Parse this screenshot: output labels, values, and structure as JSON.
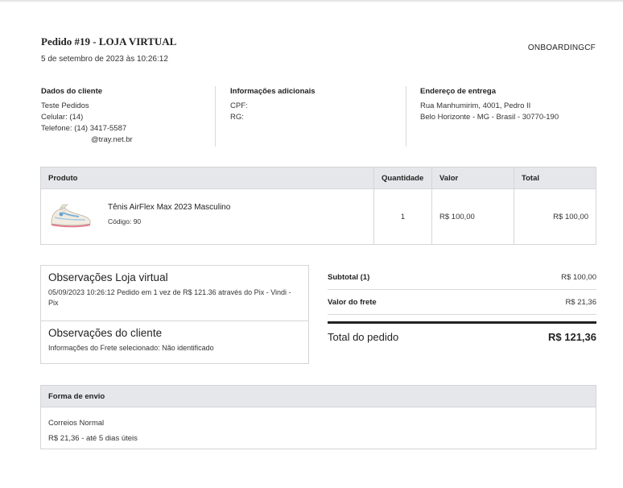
{
  "header": {
    "title": "Pedido #19 - LOJA VIRTUAL",
    "date": "5 de setembro de 2023 às 10:26:12",
    "store_code": "ONBOARDINGCF"
  },
  "customer": {
    "heading": "Dados do cliente",
    "name": "Teste Pedidos",
    "cellphone": "Celular: (14)",
    "phone": "Telefone: (14) 3417-5587",
    "email": "@tray.net.br"
  },
  "additional": {
    "heading": "Informações adicionais",
    "cpf": "CPF:",
    "rg": "RG:"
  },
  "delivery": {
    "heading": "Endereço de entrega",
    "line1": "Rua Manhumirim, 4001, Pedro II",
    "line2": "Belo Horizonte - MG - Brasil - 30770-190"
  },
  "products": {
    "columns": [
      "Produto",
      "Quantidade",
      "Valor",
      "Total"
    ],
    "items": [
      {
        "name": "Tênis AirFlex Max 2023 Masculino",
        "code_label": "Código:",
        "code": "90",
        "quantity": "1",
        "value": "R$ 100,00",
        "total": "R$ 100,00",
        "image_icon": "sneaker-icon"
      }
    ]
  },
  "observations": {
    "store_heading": "Observações Loja virtual",
    "store_text": "05/09/2023 10:26:12 Pedido em 1 vez de R$ 121.36 através do Pix - Vindi - Pix",
    "client_heading": "Observações do cliente",
    "client_text": "Informações do Frete selecionado: Não identificado"
  },
  "totals": {
    "subtotal_label": "Subtotal (1)",
    "subtotal_value": "R$ 100,00",
    "shipping_label": "Valor do frete",
    "shipping_value": "R$ 21,36",
    "total_label": "Total do pedido",
    "total_value": "R$ 121,36"
  },
  "shipping": {
    "heading": "Forma de envio",
    "method": "Correios Normal",
    "details": "R$ 21,36 - até 5 dias úteis"
  }
}
